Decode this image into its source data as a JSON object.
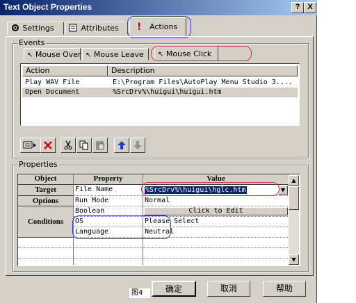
{
  "window": {
    "title": "Text Object Properties",
    "help_btn": "?",
    "close_btn": "X"
  },
  "tabs": [
    {
      "label": "Settings"
    },
    {
      "label": "Attributes"
    },
    {
      "label": "Actions"
    }
  ],
  "events": {
    "group_label": "Events",
    "subtabs": [
      {
        "label": "Mouse Over"
      },
      {
        "label": "Mouse Leave"
      },
      {
        "label": "Mouse Click"
      }
    ],
    "columns": [
      "Action",
      "Description"
    ],
    "rows": [
      {
        "action": "Play WAV File",
        "description": "E:\\Program Files\\AutoPlay Menu Studio 3...."
      },
      {
        "action": "Open Document",
        "description": "%SrcDrv%\\huigui\\huigui.htm"
      }
    ]
  },
  "toolbar": {
    "icons": [
      "add-action-icon",
      "delete-icon",
      "cut-icon",
      "copy-icon",
      "paste-icon",
      "move-up-icon",
      "move-down-icon"
    ]
  },
  "properties": {
    "group_label": "Properties",
    "columns": [
      "Object",
      "Property",
      "Value"
    ],
    "rows": [
      {
        "object": "Target",
        "property": "File Name",
        "value": "%SrcDrv%\\huigui\\hglc.htm"
      },
      {
        "object": "Options",
        "property": "Run Mode",
        "value": "Normal"
      },
      {
        "object": "",
        "property": "Boolean",
        "value": "Click to Edit"
      },
      {
        "object": "Conditions",
        "property": "OS",
        "value": "Please Select"
      },
      {
        "object": "",
        "property": "Language",
        "value": "Neutral"
      }
    ]
  },
  "caption": "图4",
  "buttons": {
    "ok": "确定",
    "cancel": "取消",
    "help": "帮助"
  }
}
